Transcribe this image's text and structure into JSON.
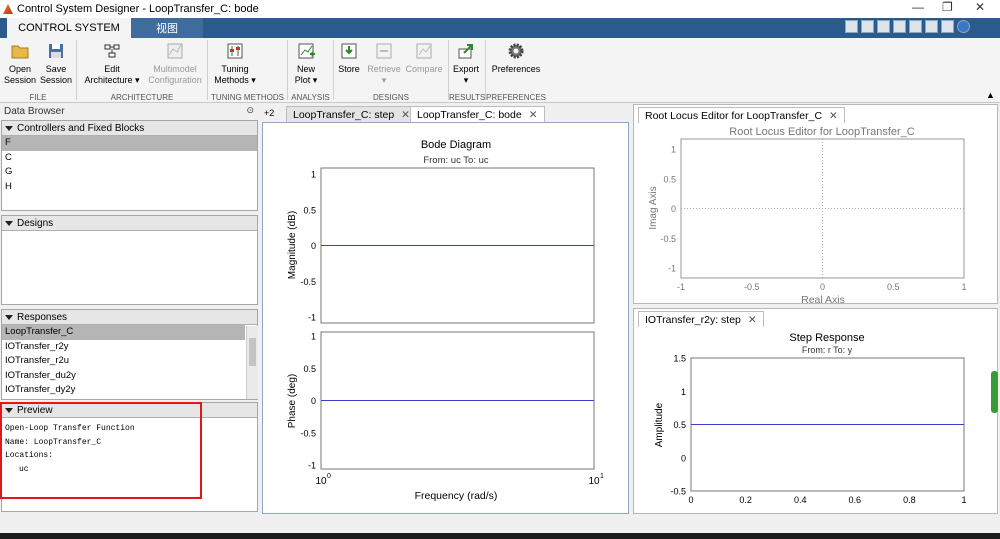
{
  "window": {
    "title": "Control System Designer - LoopTransfer_C: bode"
  },
  "ribbon_tabs": [
    "CONTROL SYSTEM",
    "视图"
  ],
  "toolbar": {
    "open": [
      "Open",
      "Session"
    ],
    "save": [
      "Save",
      "Session"
    ],
    "edit_arch": [
      "Edit",
      "Architecture ▾"
    ],
    "multimodel": [
      "Multimodel",
      "Configuration"
    ],
    "tuning": [
      "Tuning",
      "Methods ▾"
    ],
    "new_plot": [
      "New",
      "Plot ▾"
    ],
    "store": "Store",
    "retrieve": "Retrieve ▾",
    "compare": "Compare",
    "export": "Export ▾",
    "preferences": "Preferences"
  },
  "sections": [
    "FILE",
    "ARCHITECTURE",
    "TUNING METHODS",
    "ANALYSIS",
    "DESIGNS",
    "RESULTS",
    "PREFERENCES"
  ],
  "data_browser": {
    "title": "Data Browser",
    "controllers_title": "Controllers and Fixed Blocks",
    "controllers": [
      "F",
      "C",
      "G",
      "H"
    ],
    "designs_title": "Designs",
    "responses_title": "Responses",
    "responses": [
      "LoopTransfer_C",
      "IOTransfer_r2y",
      "IOTransfer_r2u",
      "IOTransfer_du2y",
      "IOTransfer_dy2y"
    ],
    "preview_title": "Preview",
    "preview_lines": [
      "Open-Loop Transfer Function",
      "Name: LoopTransfer_C",
      "Locations:",
      "uc"
    ]
  },
  "doc_tabs": {
    "overflow": "+2",
    "step": "LoopTransfer_C: step",
    "bode": "LoopTransfer_C: bode"
  },
  "right_tabs": {
    "root_locus": "Root Locus Editor for LoopTransfer_C",
    "step": "IOTransfer_r2y: step"
  },
  "colors": {
    "ribbon_blue": "#2b5a8c",
    "plot_line": "#3c3cd2",
    "highlight": "#e01818"
  },
  "chart_data": [
    {
      "type": "line",
      "title": "Bode Diagram",
      "subtitle": "From: uc  To: uc",
      "xlabel": "Frequency  (rad/s)",
      "x_scale": "log",
      "xlim": [
        1,
        10
      ],
      "x_ticks": [
        "10",
        "10"
      ],
      "x_tick_exponents": [
        "0",
        "1"
      ],
      "panels": [
        {
          "ylabel": "Magnitude (dB)",
          "ylim": [
            -1,
            1
          ],
          "yticks": [
            "1",
            "0.5",
            "0",
            "-0.5",
            "-1"
          ],
          "series": [
            {
              "x": [
                1,
                10
              ],
              "y": [
                0,
                0
              ]
            }
          ]
        },
        {
          "ylabel": "Phase (deg)",
          "ylim": [
            -1,
            1
          ],
          "yticks": [
            "1",
            "0.5",
            "0",
            "-0.5",
            "-1"
          ],
          "series": [
            {
              "x": [
                1,
                10
              ],
              "y": [
                0,
                0
              ]
            }
          ]
        }
      ]
    },
    {
      "type": "scatter",
      "title": "Root Locus Editor for LoopTransfer_C",
      "xlabel": "Real Axis",
      "ylabel": "Imag Axis",
      "xlim": [
        -1,
        1
      ],
      "ylim": [
        -1,
        1
      ],
      "xticks": [
        "-1",
        "-0.5",
        "0",
        "0.5",
        "1"
      ],
      "yticks": [
        "1",
        "0.5",
        "0",
        "-0.5",
        "-1"
      ],
      "grid": "dotted axes at 0"
    },
    {
      "type": "line",
      "title": "Step Response",
      "subtitle": "From: r  To: y",
      "ylabel": "Amplitude",
      "xlim": [
        0,
        1
      ],
      "ylim": [
        0,
        1.5
      ],
      "xticks": [
        "0",
        "0.2",
        "0.4",
        "0.6",
        "0.8",
        "1"
      ],
      "yticks": [
        "1.5",
        "1",
        "0.5",
        "0",
        "-0.5"
      ],
      "series": [
        {
          "x": [
            0,
            1
          ],
          "y": [
            0.5,
            0.5
          ]
        }
      ]
    }
  ]
}
